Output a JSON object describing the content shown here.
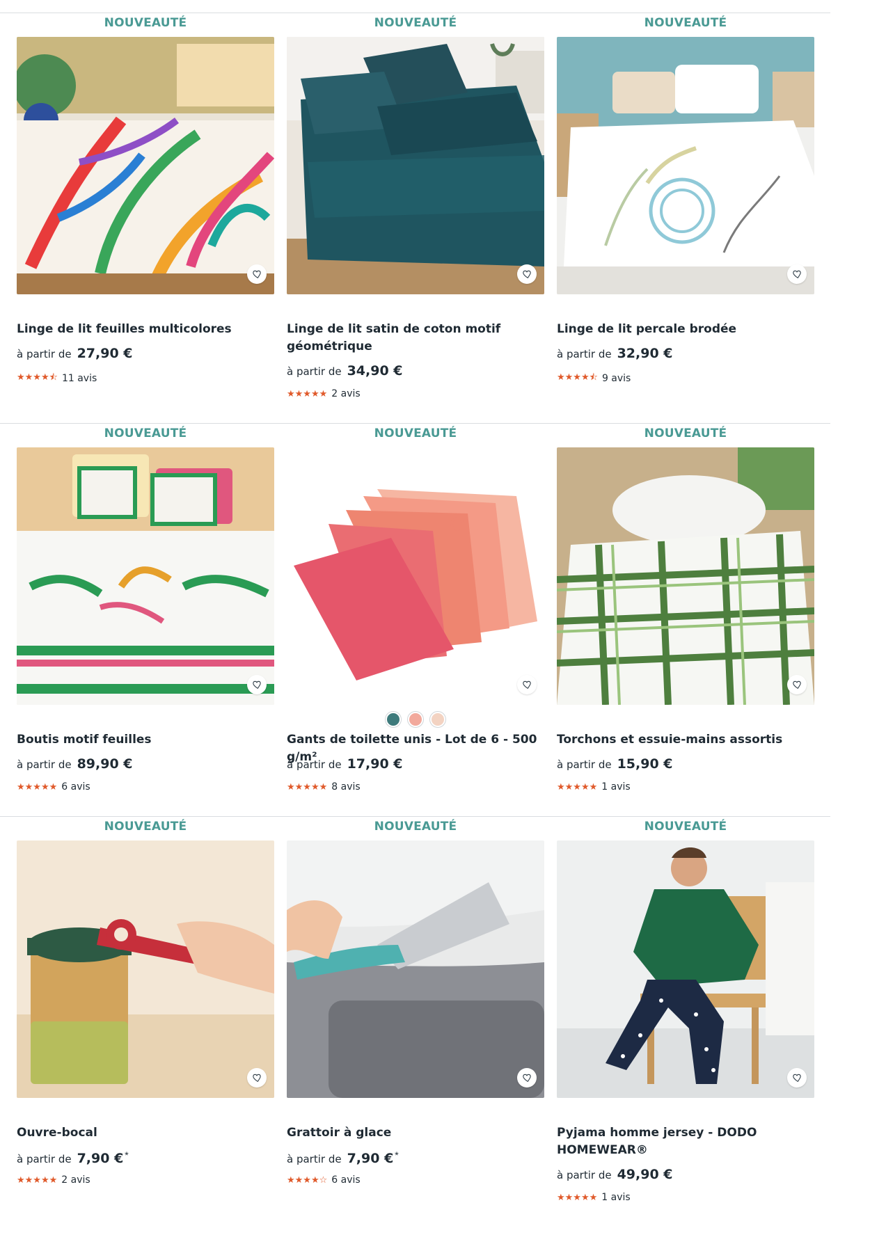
{
  "badge_text": "NOUVEAUTÉ",
  "price_prefix": "à partir de",
  "colors": {
    "accent": "#4a9a94",
    "star": "#e05a2b",
    "divider": "#d9dde0"
  },
  "products": [
    {
      "title": "Linge de lit feuilles multicolores",
      "price": "27,90 €",
      "rating": 4.5,
      "stars": "★★★★⯪",
      "reviews": "11 avis",
      "icon": "heart-icon"
    },
    {
      "title": "Linge de lit satin de coton motif géométrique",
      "price": "34,90 €",
      "rating": 5,
      "stars": "★★★★★",
      "reviews": "2 avis",
      "icon": "heart-icon"
    },
    {
      "title": "Linge de lit percale brodée",
      "price": "32,90 €",
      "rating": 4.5,
      "stars": "★★★★⯪",
      "reviews": "9 avis",
      "icon": "heart-icon"
    },
    {
      "title": "Boutis motif feuilles",
      "price": "89,90 €",
      "rating": 5,
      "stars": "★★★★★",
      "reviews": "6 avis",
      "icon": "heart-icon"
    },
    {
      "title": "Gants de toilette unis - Lot de 6 - 500 g/m²",
      "price": "17,90 €",
      "rating": 5,
      "stars": "★★★★★",
      "reviews": "8 avis",
      "icon": "heart-icon",
      "swatches": [
        "#3e7b7c",
        "#f2a99c",
        "#f3d3c2"
      ]
    },
    {
      "title": "Torchons et essuie-mains assortis",
      "price": "15,90 €",
      "rating": 5,
      "stars": "★★★★★",
      "reviews": "1 avis",
      "icon": "heart-icon"
    },
    {
      "title": "Ouvre-bocal",
      "price": "7,90 €",
      "price_note": "*",
      "rating": 5,
      "stars": "★★★★★",
      "reviews": "2 avis",
      "icon": "heart-icon"
    },
    {
      "title": "Grattoir à glace",
      "price": "7,90 €",
      "price_note": "*",
      "rating": 4,
      "stars": "★★★★☆",
      "reviews": "6 avis",
      "icon": "heart-icon"
    },
    {
      "title": "Pyjama homme jersey - DODO HOMEWEAR®",
      "price": "49,90 €",
      "rating": 5,
      "stars": "★★★★★",
      "reviews": "1 avis",
      "icon": "heart-icon"
    }
  ]
}
